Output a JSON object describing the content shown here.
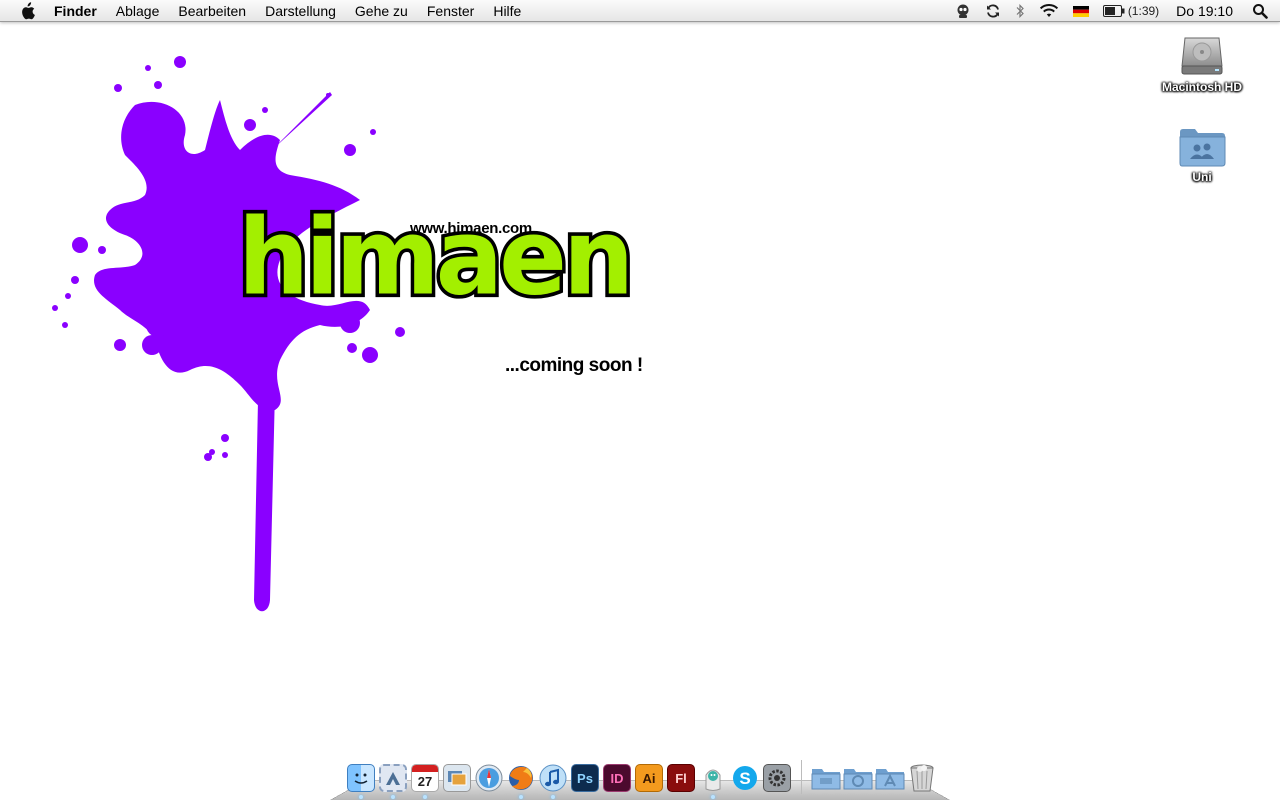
{
  "menubar": {
    "app_name": "Finder",
    "menus": [
      "Ablage",
      "Bearbeiten",
      "Darstellung",
      "Gehe zu",
      "Fenster",
      "Hilfe"
    ],
    "status_icons": [
      "robot-icon",
      "sync-icon",
      "bluetooth-icon",
      "wifi-icon",
      "flag-germany-icon",
      "battery-icon"
    ],
    "battery_text": "(1:39)",
    "clock": "Do 19:10"
  },
  "logo": {
    "url": "www.himaen.com",
    "word": "himaen",
    "slogan": "...coming soon !",
    "colors": {
      "splash": "#8a00ff",
      "letters": "#a3ef00",
      "outline": "#000000"
    }
  },
  "desktop_icons": [
    {
      "label": "Macintosh HD",
      "icon": "hard-drive-icon"
    },
    {
      "label": "Uni",
      "icon": "folder-icon"
    }
  ],
  "dock": {
    "apps": [
      {
        "icon": "finder-icon",
        "running": true
      },
      {
        "icon": "mail-stamp-icon",
        "running": true
      },
      {
        "icon": "calendar-icon",
        "date": "27",
        "running": true
      },
      {
        "icon": "preview-icon",
        "running": false
      },
      {
        "icon": "safari-icon",
        "running": false
      },
      {
        "icon": "firefox-icon",
        "running": true
      },
      {
        "icon": "itunes-icon",
        "running": true
      },
      {
        "icon": "photoshop-icon",
        "text": "Ps",
        "running": false
      },
      {
        "icon": "indesign-icon",
        "text": "ID",
        "running": false
      },
      {
        "icon": "illustrator-icon",
        "text": "Ai",
        "running": false
      },
      {
        "icon": "flash-icon",
        "text": "Fl",
        "running": false
      },
      {
        "icon": "adium-icon",
        "running": true
      },
      {
        "icon": "skype-icon",
        "running": false
      },
      {
        "icon": "system-preferences-icon",
        "running": false
      }
    ],
    "stacks": [
      "documents-stack-icon",
      "downloads-stack-icon",
      "applications-stack-icon"
    ],
    "trash": "trash-icon"
  }
}
